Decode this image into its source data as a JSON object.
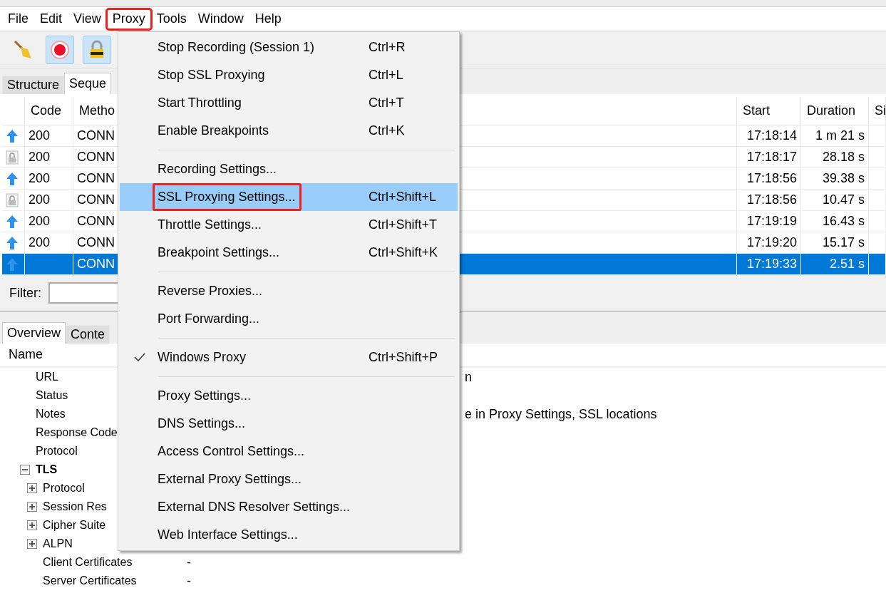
{
  "menu_bar": [
    {
      "label": "File",
      "open": false
    },
    {
      "label": "Edit",
      "open": false
    },
    {
      "label": "View",
      "open": false
    },
    {
      "label": "Proxy",
      "open": true
    },
    {
      "label": "Tools",
      "open": false
    },
    {
      "label": "Window",
      "open": false
    },
    {
      "label": "Help",
      "open": false
    }
  ],
  "toolbar": [
    {
      "kind": "broom",
      "pressed": false
    },
    {
      "kind": "record",
      "pressed": true
    },
    {
      "kind": "lock",
      "pressed": true
    }
  ],
  "view_tabs": [
    {
      "label": "Structure",
      "selected": false
    },
    {
      "label": "Seque",
      "selected": true
    }
  ],
  "table": {
    "columns": [
      "Code",
      "Metho",
      "Start",
      "Duration",
      "Si"
    ],
    "rows": [
      {
        "kind": "arrow",
        "code": "200",
        "method": "CONN",
        "start": "17:18:14",
        "duration": "1 m 21 s",
        "selected": false
      },
      {
        "kind": "lock",
        "code": "200",
        "method": "CONN",
        "start": "17:18:17",
        "duration": "28.18 s",
        "selected": false
      },
      {
        "kind": "arrow",
        "code": "200",
        "method": "CONN",
        "start": "17:18:56",
        "duration": "39.38 s",
        "selected": false
      },
      {
        "kind": "lock",
        "code": "200",
        "method": "CONN",
        "start": "17:18:56",
        "duration": "10.47 s",
        "selected": false
      },
      {
        "kind": "arrow",
        "code": "200",
        "method": "CONN",
        "start": "17:19:19",
        "duration": "16.43 s",
        "selected": false
      },
      {
        "kind": "arrow",
        "code": "200",
        "method": "CONN",
        "start": "17:19:20",
        "duration": "15.17 s",
        "selected": false
      },
      {
        "kind": "arrow",
        "method": "CONN",
        "start": "17:19:33",
        "duration": "2.51 s",
        "selected": true
      }
    ]
  },
  "filter": {
    "label": "Filter:"
  },
  "detail_tabs": [
    {
      "label": "Overview",
      "selected": true
    },
    {
      "label": "Conte",
      "selected": false
    }
  ],
  "overview": {
    "header": "Name",
    "rows": [
      {
        "name": "URL",
        "value_end": "n"
      },
      {
        "name": "Status"
      },
      {
        "name": "Notes",
        "value_end": "e in Proxy Settings, SSL locations"
      },
      {
        "name": "Response Code"
      },
      {
        "name": "Protocol"
      },
      {
        "name": "TLS",
        "expanded": true,
        "children": [
          {
            "name": "Protocol",
            "expanded": false
          },
          {
            "name": "Session Res",
            "expanded": false
          },
          {
            "name": "Cipher Suite",
            "expanded": false
          },
          {
            "name": "ALPN",
            "expanded": false
          },
          {
            "name": "Client Certificates",
            "value": "-"
          },
          {
            "name": "Server Certificates",
            "value": "-"
          }
        ]
      }
    ]
  },
  "proxy_menu": [
    {
      "kind": "item",
      "label": "Stop Recording (Session 1)",
      "shortcut": "Ctrl+R",
      "checked": false,
      "selected": false,
      "annotated": false
    },
    {
      "kind": "item",
      "label": "Stop SSL Proxying",
      "shortcut": "Ctrl+L",
      "checked": false,
      "selected": false,
      "annotated": false
    },
    {
      "kind": "item",
      "label": "Start Throttling",
      "shortcut": "Ctrl+T",
      "checked": false,
      "selected": false,
      "annotated": false
    },
    {
      "kind": "item",
      "label": "Enable Breakpoints",
      "shortcut": "Ctrl+K",
      "checked": false,
      "selected": false,
      "annotated": false
    },
    {
      "kind": "separator"
    },
    {
      "kind": "item",
      "label": "Recording Settings...",
      "checked": false,
      "selected": false,
      "annotated": false
    },
    {
      "kind": "item",
      "label": "SSL Proxying Settings...",
      "shortcut": "Ctrl+Shift+L",
      "checked": false,
      "selected": true,
      "annotated": true
    },
    {
      "kind": "item",
      "label": "Throttle Settings...",
      "shortcut": "Ctrl+Shift+T",
      "checked": false,
      "selected": false,
      "annotated": false
    },
    {
      "kind": "item",
      "label": "Breakpoint Settings...",
      "shortcut": "Ctrl+Shift+K",
      "checked": false,
      "selected": false,
      "annotated": false
    },
    {
      "kind": "separator"
    },
    {
      "kind": "item",
      "label": "Reverse Proxies...",
      "checked": false,
      "selected": false,
      "annotated": false
    },
    {
      "kind": "item",
      "label": "Port Forwarding...",
      "checked": false,
      "selected": false,
      "annotated": false
    },
    {
      "kind": "separator"
    },
    {
      "kind": "item",
      "label": "Windows Proxy",
      "shortcut": "Ctrl+Shift+P",
      "checked": true,
      "selected": false,
      "annotated": false
    },
    {
      "kind": "separator"
    },
    {
      "kind": "item",
      "label": "Proxy Settings...",
      "checked": false,
      "selected": false,
      "annotated": false
    },
    {
      "kind": "item",
      "label": "DNS Settings...",
      "checked": false,
      "selected": false,
      "annotated": false
    },
    {
      "kind": "item",
      "label": "Access Control Settings...",
      "checked": false,
      "selected": false,
      "annotated": false
    },
    {
      "kind": "item",
      "label": "External Proxy Settings...",
      "checked": false,
      "selected": false,
      "annotated": false
    },
    {
      "kind": "item",
      "label": "External DNS Resolver Settings...",
      "checked": false,
      "selected": false,
      "annotated": false
    },
    {
      "kind": "item",
      "label": "Web Interface Settings...",
      "checked": false,
      "selected": false,
      "annotated": false
    }
  ]
}
